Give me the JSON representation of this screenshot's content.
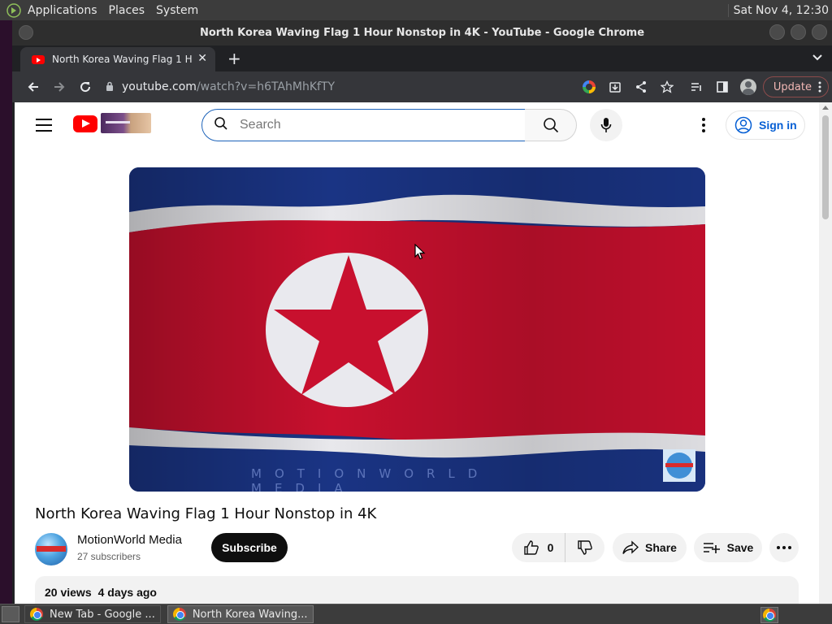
{
  "top_panel": {
    "menus": [
      "Applications",
      "Places",
      "System"
    ],
    "clock": "Sat Nov  4, 12:30"
  },
  "window": {
    "title": "North Korea Waving Flag 1 Hour Nonstop in 4K - YouTube - Google Chrome"
  },
  "tab": {
    "title": "North Korea Waving Flag 1 Hour Nonstop in 4K",
    "close": "✕",
    "new_tab": "+"
  },
  "toolbar": {
    "url_host": "youtube.com",
    "url_path": "/watch?v=h6TAhMhKfTY",
    "update_label": "Update"
  },
  "youtube": {
    "search_placeholder": "Search",
    "sign_in": "Sign in",
    "watermark": "MOTIONWORLD MEDIA",
    "video_title": "North Korea Waving Flag 1 Hour Nonstop in 4K",
    "channel_name": "MotionWorld Media",
    "subscribers": "27 subscribers",
    "subscribe_label": "Subscribe",
    "like_count": "0",
    "share_label": "Share",
    "save_label": "Save",
    "views": "20 views",
    "age": "4 days ago"
  },
  "taskbar": {
    "tasks": [
      {
        "label": "New Tab - Google ..."
      },
      {
        "label": "North Korea Waving..."
      }
    ]
  },
  "colors": {
    "yt_red": "#ff0000",
    "link_blue": "#065fd4",
    "flag_red": "#c8102e",
    "flag_blue": "#1e3f9a"
  }
}
